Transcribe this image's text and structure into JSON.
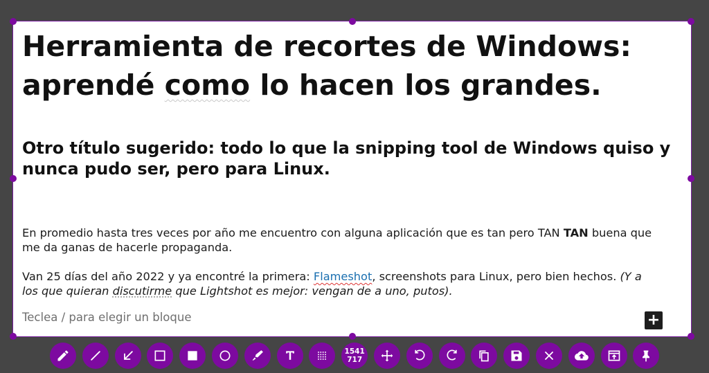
{
  "document": {
    "title_main": "Herramienta de recortes de Windows:",
    "title_second_pre": "aprendé ",
    "title_second_spell": "como",
    "title_second_post": " lo hacen los grandes.",
    "subtitle": "Otro título sugerido: todo lo que la snipping tool de Windows quiso y nunca pudo ser, pero para Linux.",
    "p1_text": "En promedio hasta tres veces por año me encuentro con alguna aplicación que es tan pero TAN ",
    "p1_bold": "TAN",
    "p1_end": " buena que me da ganas de hacerle propaganda.",
    "p2_pre": "Van 25 días del año 2022 y ya encontré la primera: ",
    "p2_link": "Flameshot",
    "p2_mid": ", screenshots para Linux, pero bien hechos. ",
    "p2_italic_a": "(Y a los que quieran ",
    "p2_italic_b": "discutirme",
    "p2_italic_c": " que Lightshot es mejor: vengan de a uno, putos).",
    "block_placeholder": "Teclea / para elegir un bloque",
    "add_block_symbol": "+"
  },
  "selection": {
    "width": "1541",
    "height": "717"
  },
  "toolbar": {
    "tools": [
      "pencil-icon",
      "line-icon",
      "arrow-icon",
      "rectangle-icon",
      "filled-rectangle-icon",
      "circle-icon",
      "marker-icon",
      "text-icon",
      "pixelate-icon",
      "selection-size",
      "move-icon",
      "undo-icon",
      "redo-icon",
      "copy-icon",
      "save-icon",
      "close-icon",
      "upload-icon",
      "open-app-icon",
      "pin-icon"
    ]
  },
  "colors": {
    "accent": "#7d0aa0",
    "background": "#454545",
    "link": "#1a6fb0"
  }
}
